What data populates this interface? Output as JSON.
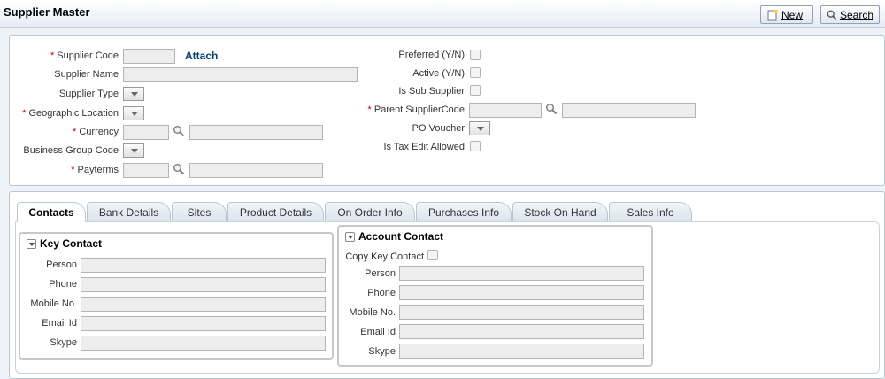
{
  "header": {
    "title": "Supplier Master",
    "new_label": "New",
    "search_label": "Search"
  },
  "form": {
    "supplier_code_label": "Supplier Code",
    "attach_label": "Attach",
    "supplier_name_label": "Supplier Name",
    "supplier_type_label": "Supplier Type",
    "geographic_location_label": "Geographic Location",
    "currency_label": "Currency",
    "business_group_code_label": "Business Group Code",
    "payterms_label": "Payterms",
    "preferred_label": "Preferred (Y/N)",
    "active_label": "Active (Y/N)",
    "is_sub_supplier_label": "Is Sub Supplier",
    "parent_supplier_code_label": "Parent SupplierCode",
    "po_voucher_label": "PO Voucher",
    "is_tax_edit_allowed_label": "Is Tax Edit Allowed",
    "required_marker": "*"
  },
  "tabs": [
    {
      "label": "Contacts"
    },
    {
      "label": "Bank Details"
    },
    {
      "label": "Sites"
    },
    {
      "label": "Product Details"
    },
    {
      "label": "On Order Info"
    },
    {
      "label": "Purchases Info"
    },
    {
      "label": "Stock On Hand"
    },
    {
      "label": "Sales Info"
    }
  ],
  "key_contact": {
    "title": "Key Contact",
    "person_label": "Person",
    "phone_label": "Phone",
    "mobile_label": "Mobile No.",
    "email_label": "Email Id",
    "skype_label": "Skype"
  },
  "account_contact": {
    "title": "Account Contact",
    "copy_label": "Copy Key Contact",
    "person_label": "Person",
    "phone_label": "Phone",
    "mobile_label": "Mobile No.",
    "email_label": "Email Id",
    "skype_label": "Skype"
  },
  "icons": {
    "new": "new-document-icon",
    "search": "magnifier-icon",
    "lookup": "magnifier-icon",
    "collapse": "chevron-down-icon",
    "dropdown": "triangle-down-icon"
  }
}
